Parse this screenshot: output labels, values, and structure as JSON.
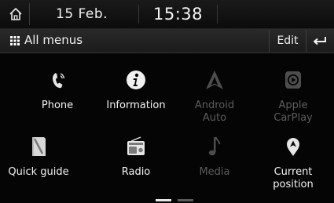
{
  "status_bar": {
    "date": "15 Feb.",
    "time": "15:38"
  },
  "header": {
    "title": "All menus",
    "edit_label": "Edit"
  },
  "menu_items": [
    {
      "label": "Phone",
      "icon": "phone-icon",
      "enabled": true
    },
    {
      "label": "Information",
      "icon": "information-icon",
      "enabled": true
    },
    {
      "label": "Android\nAuto",
      "icon": "android-auto-icon",
      "enabled": false
    },
    {
      "label": "Apple\nCarPlay",
      "icon": "apple-carplay-icon",
      "enabled": false
    },
    {
      "label": "Quick guide",
      "icon": "quick-guide-icon",
      "enabled": true
    },
    {
      "label": "Radio",
      "icon": "radio-icon",
      "enabled": true
    },
    {
      "label": "Media",
      "icon": "media-icon",
      "enabled": false
    },
    {
      "label": "Current\nposition",
      "icon": "location-pin-icon",
      "enabled": true
    }
  ],
  "page_indicator": {
    "pages": 2,
    "current": 1
  },
  "colors": {
    "background": "#050505",
    "text": "#f2f2f2",
    "disabled": "#5c5c5c",
    "active_page": "#e8e8e8",
    "inactive_page": "#5a5a5a"
  }
}
